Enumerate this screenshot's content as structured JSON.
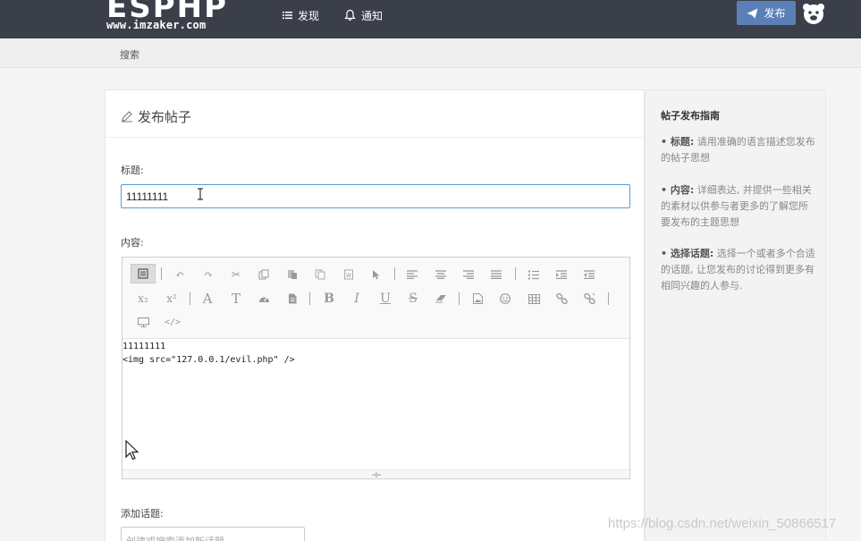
{
  "header": {
    "logo_text": "ESPHP",
    "logo_subtext": "www.imzaker.com",
    "nav": [
      {
        "label": "发现",
        "icon": "list-icon"
      },
      {
        "label": "通知",
        "icon": "bell-icon"
      }
    ],
    "publish_label": "发布"
  },
  "subnav": {
    "search_label": "搜索"
  },
  "form": {
    "panel_title": "发布帖子",
    "title_label": "标题:",
    "title_value": "11111111",
    "content_label": "内容:",
    "content_lines": [
      "11111111",
      "<img src=\"127.0.0.1/evil.php\" />"
    ],
    "topic_label": "添加话题:",
    "topic_placeholder": "创建或搜索添加新话题"
  },
  "toolbar_icons": [
    "source-icon",
    "undo-icon",
    "redo-icon",
    "cut-icon",
    "copy-icon",
    "paste-icon",
    "paste-text-icon",
    "paste-word-icon",
    "select-all-icon",
    "align-left-icon",
    "align-center-icon",
    "align-right-icon",
    "justify-icon",
    "ordered-list-icon",
    "indent-icon",
    "outdent-icon",
    "subscript-icon",
    "superscript-icon",
    "font-color-icon",
    "font-size-icon",
    "speed-icon",
    "template-icon",
    "bold-icon",
    "italic-icon",
    "underline-icon",
    "strikethrough-icon",
    "eraser-icon",
    "image-icon",
    "emoticon-icon",
    "table-icon",
    "link-icon",
    "unlink-icon",
    "preview-icon",
    "code-icon"
  ],
  "sidebar": {
    "title": "帖子发布指南",
    "items": [
      {
        "bold": "• 标题:",
        "text": " 请用准确的语言描述您发布的帖子思想"
      },
      {
        "bold": "• 内容:",
        "text": " 详细表达, 并提供一些相关的素材以供参与者更多的了解您所要发布的主题思想"
      },
      {
        "bold": "• 选择话题:",
        "text": " 选择一个或者多个合适的话题, 让您发布的讨论得到更多有相同兴趣的人参与."
      }
    ]
  },
  "watermark": "https://blog.csdn.net/weixin_50866517",
  "colors": {
    "topbar": "#3b3f4a",
    "accent": "#5b80b7",
    "input_focus": "#5b9bd5"
  }
}
